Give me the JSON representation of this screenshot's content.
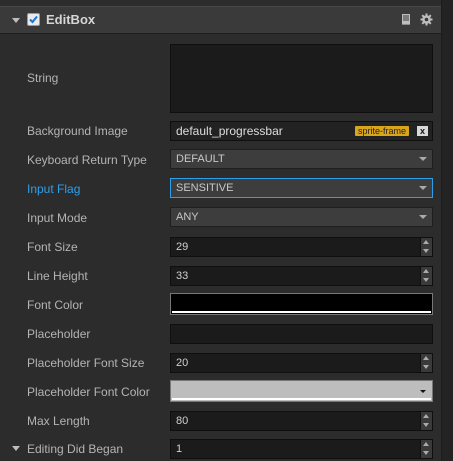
{
  "component": {
    "title": "EditBox",
    "enabled": true
  },
  "rows": {
    "string": {
      "label": "String",
      "value": ""
    },
    "background_image": {
      "label": "Background Image",
      "value": "default_progressbar",
      "tag": "sprite-frame",
      "clear": "x"
    },
    "keyboard_return_type": {
      "label": "Keyboard Return Type",
      "value": "DEFAULT"
    },
    "input_flag": {
      "label": "Input Flag",
      "value": "SENSITIVE"
    },
    "input_mode": {
      "label": "Input Mode",
      "value": "ANY"
    },
    "font_size": {
      "label": "Font Size",
      "value": "29"
    },
    "line_height": {
      "label": "Line Height",
      "value": "33"
    },
    "font_color": {
      "label": "Font Color",
      "color": "#000000"
    },
    "placeholder": {
      "label": "Placeholder",
      "value": ""
    },
    "placeholder_font_size": {
      "label": "Placeholder Font Size",
      "value": "20"
    },
    "placeholder_font_color": {
      "label": "Placeholder Font Color",
      "color": "#bdbdbd"
    },
    "max_length": {
      "label": "Max Length",
      "value": "80"
    },
    "editing_did_began": {
      "label": "Editing Did Began",
      "value": "1"
    }
  },
  "colors": {
    "accent": "#2f9ee8",
    "tag": "#d9a51d"
  }
}
